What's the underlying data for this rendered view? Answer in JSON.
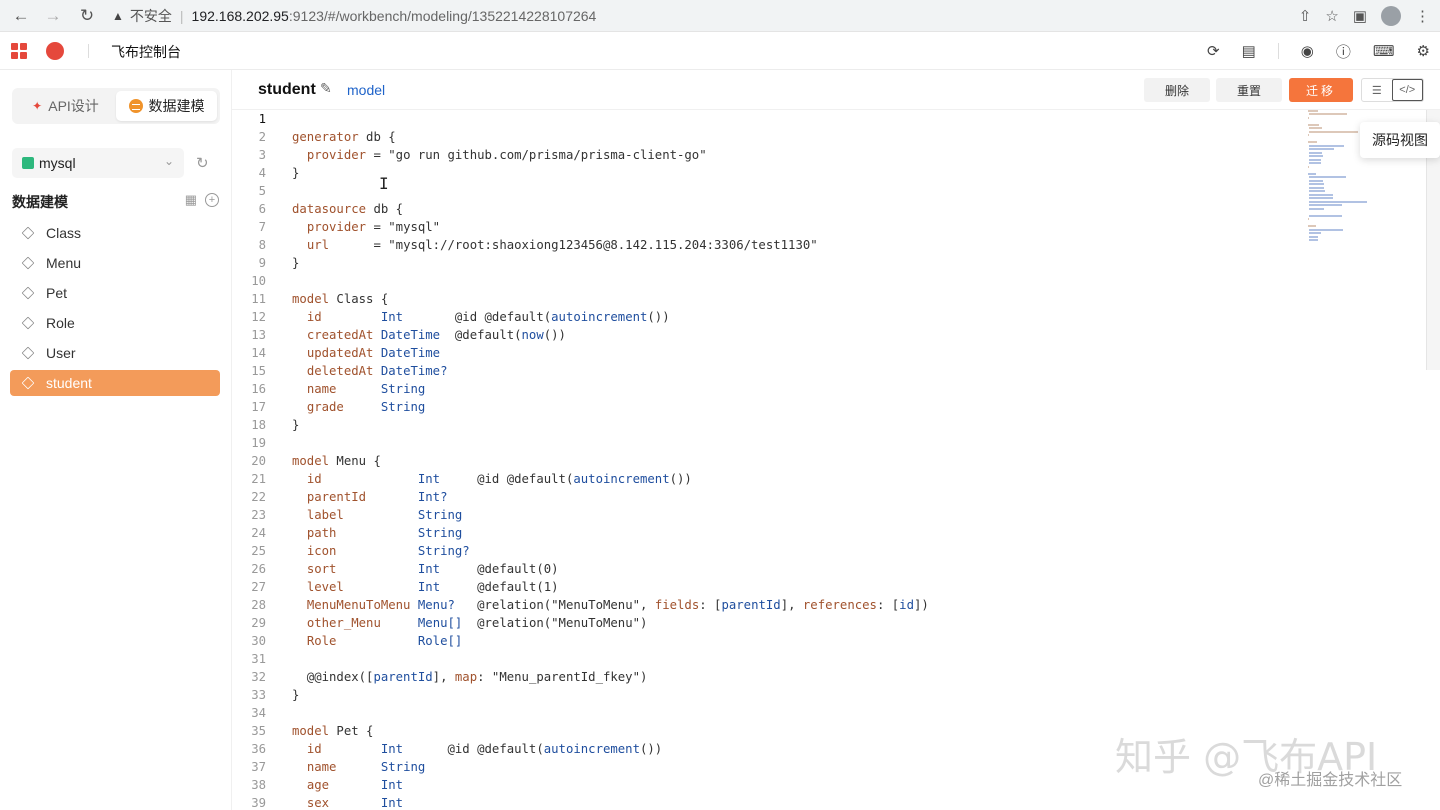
{
  "browser": {
    "insecure_label": "不安全",
    "url_host": "192.168.202.95",
    "url_path": ":9123/#/workbench/modeling/1352214228107264"
  },
  "app": {
    "title": "飞布控制台"
  },
  "sidebar": {
    "tabs": [
      {
        "label": "API设计",
        "active": false
      },
      {
        "label": "数据建模",
        "active": true
      }
    ],
    "db_select": {
      "value": "mysql"
    },
    "section_title": "数据建模",
    "models": [
      {
        "label": "Class"
      },
      {
        "label": "Menu"
      },
      {
        "label": "Pet"
      },
      {
        "label": "Role"
      },
      {
        "label": "User"
      },
      {
        "label": "student",
        "active": true
      }
    ]
  },
  "doc": {
    "title": "student",
    "subtitle": "model",
    "buttons": {
      "delete": "删除",
      "reset": "重置",
      "migrate": "迁移"
    },
    "source_view_tooltip": "源码视图"
  },
  "editor": {
    "current_line": 1,
    "lines": [
      "",
      "generator db {",
      "  provider = \"go run github.com/prisma/prisma-client-go\"",
      "}",
      "",
      "datasource db {",
      "  provider = \"mysql\"",
      "  url      = \"mysql://root:shaoxiong123456@8.142.115.204:3306/test1130\"",
      "}",
      "",
      "model Class {",
      "  id        Int       @id @default(autoincrement())",
      "  createdAt DateTime  @default(now())",
      "  updatedAt DateTime",
      "  deletedAt DateTime?",
      "  name      String",
      "  grade     String",
      "}",
      "",
      "model Menu {",
      "  id             Int     @id @default(autoincrement())",
      "  parentId       Int?",
      "  label          String",
      "  path           String",
      "  icon           String?",
      "  sort           Int     @default(0)",
      "  level          Int     @default(1)",
      "  MenuMenuToMenu Menu?   @relation(\"MenuToMenu\", fields: [parentId], references: [id])",
      "  other_Menu     Menu[]  @relation(\"MenuToMenu\")",
      "  Role           Role[]",
      "",
      "  @@index([parentId], map: \"Menu_parentId_fkey\")",
      "}",
      "",
      "model Pet {",
      "  id        Int      @id @default(autoincrement())",
      "  name      String",
      "  age       Int",
      "  sex       Int"
    ]
  },
  "watermark": {
    "main": "知乎 @飞布API",
    "sub": "@稀土掘金技术社区"
  },
  "colors": {
    "accent": "#f39b5a",
    "migrate": "#f5753c",
    "brand": "#e5483c",
    "keyword": "#a0522d",
    "type": "#1f4e9e"
  }
}
